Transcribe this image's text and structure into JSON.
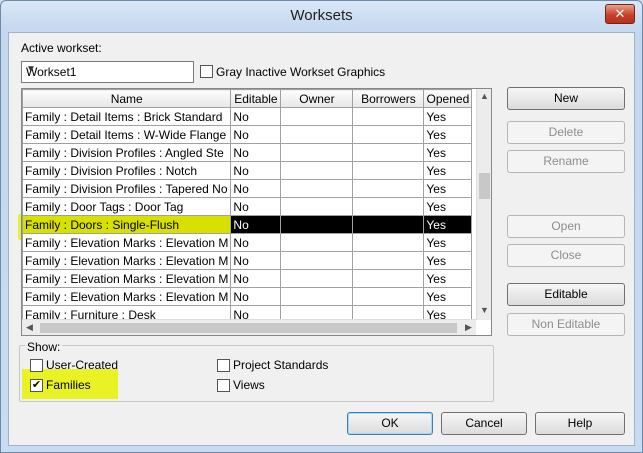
{
  "window": {
    "title": "Worksets",
    "close_label": "✕"
  },
  "active_workset": {
    "label": "Active workset:",
    "value": "Workset1",
    "gray_inactive_label": "Gray Inactive Workset Graphics",
    "gray_inactive_checked": false
  },
  "grid": {
    "columns": [
      "Name",
      "Editable",
      "Owner",
      "Borrowers",
      "Opened"
    ],
    "rows": [
      {
        "name": "Family  : Detail Items : Brick Standard",
        "editable": "No",
        "owner": "",
        "borrowers": "",
        "opened": "Yes"
      },
      {
        "name": "Family  : Detail Items : W-Wide Flange",
        "editable": "No",
        "owner": "",
        "borrowers": "",
        "opened": "Yes"
      },
      {
        "name": "Family  : Division Profiles : Angled Ste",
        "editable": "No",
        "owner": "",
        "borrowers": "",
        "opened": "Yes"
      },
      {
        "name": "Family  : Division Profiles : Notch",
        "editable": "No",
        "owner": "",
        "borrowers": "",
        "opened": "Yes"
      },
      {
        "name": "Family  : Division Profiles : Tapered No",
        "editable": "No",
        "owner": "",
        "borrowers": "",
        "opened": "Yes"
      },
      {
        "name": "Family  : Door Tags : Door Tag",
        "editable": "No",
        "owner": "",
        "borrowers": "",
        "opened": "Yes"
      },
      {
        "name": "Family  : Doors : Single-Flush",
        "editable": "No",
        "owner": "",
        "borrowers": "",
        "opened": "Yes",
        "selected": true
      },
      {
        "name": "Family  : Elevation Marks : Elevation M",
        "editable": "No",
        "owner": "",
        "borrowers": "",
        "opened": "Yes"
      },
      {
        "name": "Family  : Elevation Marks : Elevation M",
        "editable": "No",
        "owner": "",
        "borrowers": "",
        "opened": "Yes"
      },
      {
        "name": "Family  : Elevation Marks : Elevation M",
        "editable": "No",
        "owner": "",
        "borrowers": "",
        "opened": "Yes"
      },
      {
        "name": "Family  : Elevation Marks : Elevation M",
        "editable": "No",
        "owner": "",
        "borrowers": "",
        "opened": "Yes"
      },
      {
        "name": "Family  : Furniture : Desk",
        "editable": "No",
        "owner": "",
        "borrowers": "",
        "opened": "Yes"
      }
    ]
  },
  "side_buttons": {
    "new": "New",
    "delete": "Delete",
    "rename": "Rename",
    "open": "Open",
    "close": "Close",
    "editable": "Editable",
    "non_editable": "Non Editable"
  },
  "show": {
    "label": "Show:",
    "user_created": {
      "label": "User-Created",
      "checked": false
    },
    "families": {
      "label": "Families",
      "checked": true
    },
    "project_standards": {
      "label": "Project Standards",
      "checked": false
    },
    "views": {
      "label": "Views",
      "checked": false
    }
  },
  "footer": {
    "ok": "OK",
    "cancel": "Cancel",
    "help": "Help"
  },
  "colors": {
    "highlight": "#e1f000",
    "selected_row": "#000000"
  }
}
